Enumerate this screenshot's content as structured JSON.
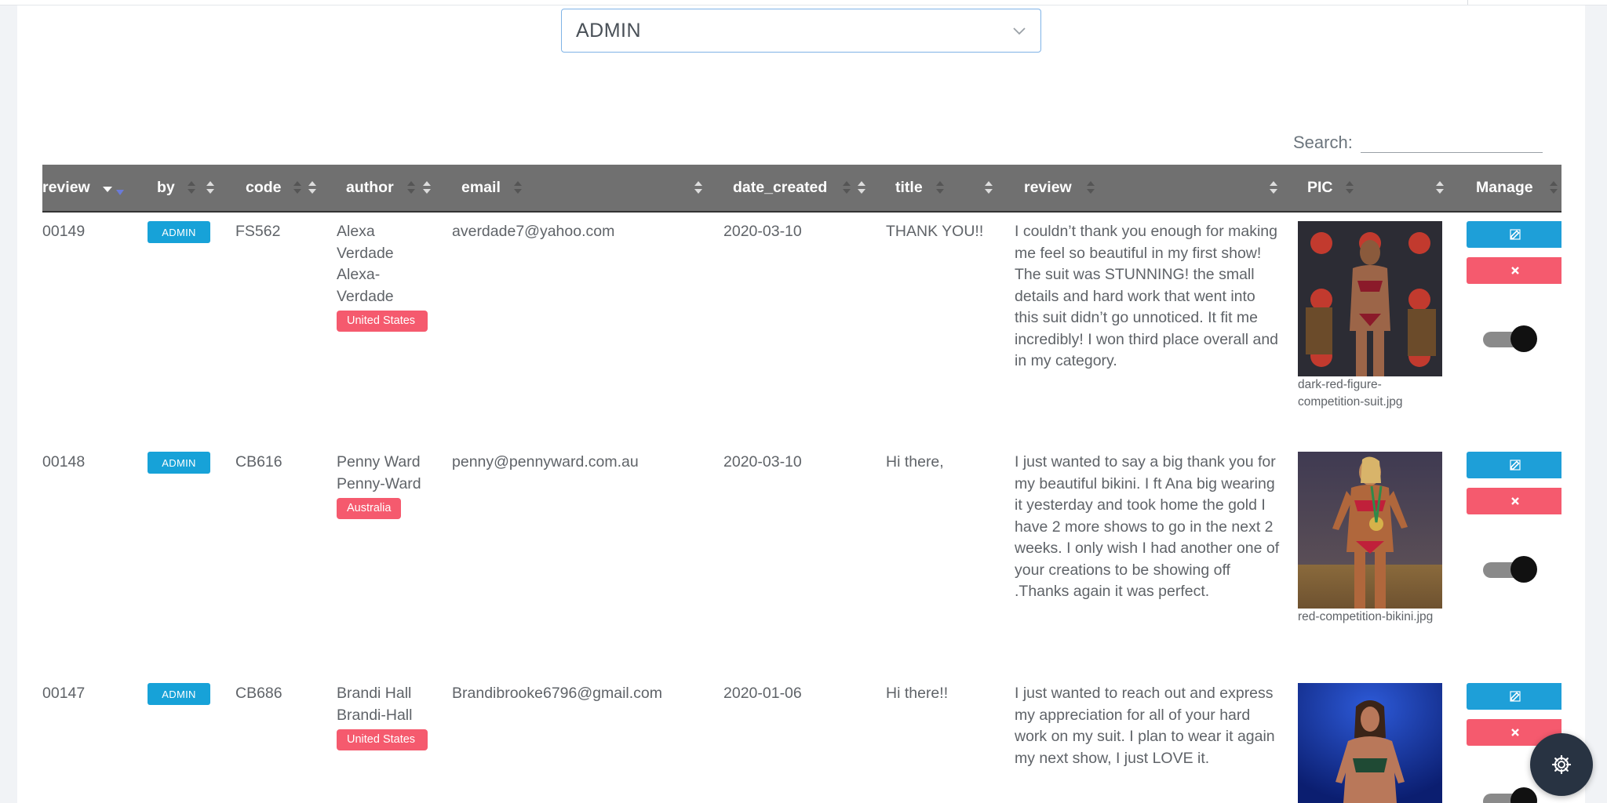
{
  "filter": {
    "selected": "ADMIN"
  },
  "search": {
    "label": "Search:",
    "placeholder": ""
  },
  "table": {
    "headers": [
      "review",
      "by",
      "code",
      "author",
      "email",
      "date_created",
      "title",
      "review",
      "PIC",
      "Manage"
    ],
    "rows": [
      {
        "id": "00149",
        "by": "ADMIN",
        "code": "FS562",
        "author_name": "Alexa Verdade",
        "author_slug": "Alexa-Verdade",
        "country": "United States",
        "email": "averdade7@yahoo.com",
        "date_created": "2020-03-10",
        "title": "THANK YOU!!",
        "review": "I couldn’t thank you enough for making me feel so beautiful in my first show! The suit was STUNNING! the small details and hard work that went into this suit didn’t go unnoticed. It fit me incredibly! I won third place overall and in my category.",
        "pic": "dark-red-figure-competition-suit.jpg",
        "enabled": true
      },
      {
        "id": "00148",
        "by": "ADMIN",
        "code": "CB616",
        "author_name": "Penny Ward",
        "author_slug": "Penny-Ward",
        "country": "Australia",
        "email": "penny@pennyward.com.au",
        "date_created": "2020-03-10",
        "title": "Hi there,",
        "review": "I just wanted to say a big thank you for my beautiful bikini. I ft Ana big wearing it yesterday and took home the gold I have 2 more shows to go in the next 2 weeks. I only wish I had another one of your creations to be showing off .Thanks again it was perfect.",
        "pic": "red-competition-bikini.jpg",
        "enabled": true
      },
      {
        "id": "00147",
        "by": "ADMIN",
        "code": "CB686",
        "author_name": "Brandi Hall",
        "author_slug": "Brandi-Hall",
        "country": "United States",
        "email": "Brandibrooke6796@gmail.com",
        "date_created": "2020-01-06",
        "title": "Hi there!!",
        "review": "I just wanted to reach out and express my appreciation for all of your hard work on my suit. I plan to wear it again my next show, I just LOVE it.",
        "pic": "",
        "enabled": true
      }
    ]
  },
  "icons": {
    "select": "chevron-down-icon",
    "edit": "edit-icon",
    "delete": "close-icon",
    "settings": "gear-icon",
    "sort": "sort-icon"
  },
  "colors": {
    "header_bg": "#707070",
    "admin_badge": "#17a2d8",
    "country_badge": "#f55a6e",
    "edit_button": "#1e9fd8",
    "delete_button": "#f55a6e",
    "fab": "#283342"
  }
}
